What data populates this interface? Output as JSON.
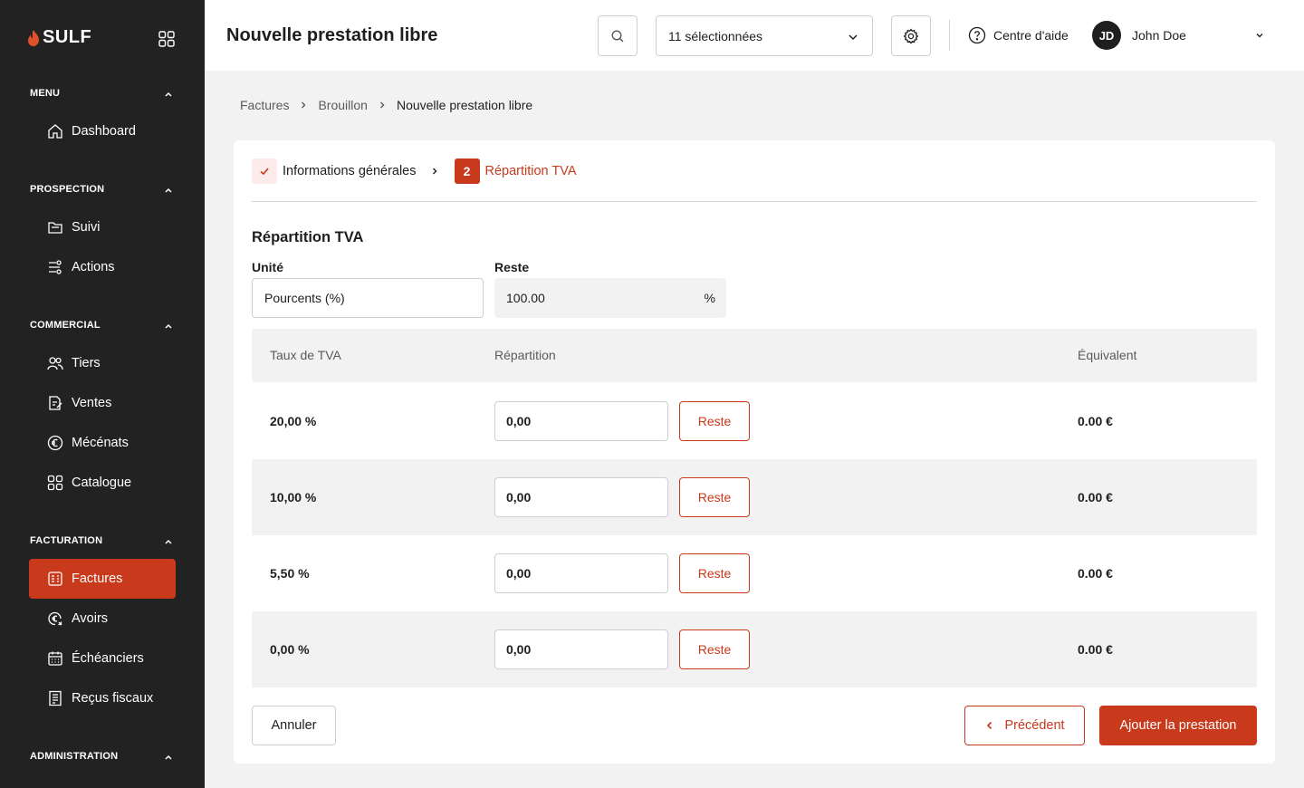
{
  "brand": {
    "name": "SULF"
  },
  "sidebar": {
    "sections": [
      {
        "title": "MENU",
        "items": [
          {
            "label": "Dashboard",
            "icon": "home-icon"
          }
        ]
      },
      {
        "title": "PROSPECTION",
        "items": [
          {
            "label": "Suivi",
            "icon": "folder-icon"
          },
          {
            "label": "Actions",
            "icon": "actions-icon"
          }
        ]
      },
      {
        "title": "COMMERCIAL",
        "items": [
          {
            "label": "Tiers",
            "icon": "users-icon"
          },
          {
            "label": "Ventes",
            "icon": "document-edit-icon"
          },
          {
            "label": "Mécénats",
            "icon": "euro-circle-icon"
          },
          {
            "label": "Catalogue",
            "icon": "grid-icon"
          }
        ]
      },
      {
        "title": "FACTURATION",
        "items": [
          {
            "label": "Factures",
            "icon": "invoice-icon"
          },
          {
            "label": "Avoirs",
            "icon": "euro-refund-icon"
          },
          {
            "label": "Échéanciers",
            "icon": "calendar-icon"
          },
          {
            "label": "Reçus fiscaux",
            "icon": "receipt-icon"
          }
        ]
      },
      {
        "title": "ADMINISTRATION",
        "items": []
      }
    ],
    "active_item": "Factures"
  },
  "header": {
    "title": "Nouvelle prestation libre",
    "selection_label": "11 sélectionnées",
    "help_label": "Centre d'aide",
    "user_initials": "JD",
    "user_name": "John Doe"
  },
  "breadcrumb": [
    "Factures",
    "Brouillon",
    "Nouvelle prestation libre"
  ],
  "steps": [
    {
      "label": "Informations générales",
      "status": "done"
    },
    {
      "number": "2",
      "label": "Répartition TVA",
      "status": "active"
    }
  ],
  "form": {
    "section_title": "Répartition TVA",
    "unit_label": "Unité",
    "unit_value": "Pourcents (%)",
    "reste_label": "Reste",
    "reste_value": "100.00",
    "reste_suffix": "%"
  },
  "table": {
    "headers": [
      "Taux de TVA",
      "Répartition",
      "Équivalent"
    ],
    "rows": [
      {
        "rate": "20,00 %",
        "value": "0,00",
        "button": "Reste",
        "equivalent": "0.00 €"
      },
      {
        "rate": "10,00 %",
        "value": "0,00",
        "button": "Reste",
        "equivalent": "0.00 €"
      },
      {
        "rate": "5,50 %",
        "value": "0,00",
        "button": "Reste",
        "equivalent": "0.00 €"
      },
      {
        "rate": "0,00 %",
        "value": "0,00",
        "button": "Reste",
        "equivalent": "0.00 €"
      }
    ]
  },
  "actions": {
    "cancel": "Annuler",
    "previous": "Précédent",
    "submit": "Ajouter la prestation"
  },
  "colors": {
    "accent": "#c9391b",
    "sidebar_bg": "#222222",
    "page_bg": "#f2f2f2"
  }
}
